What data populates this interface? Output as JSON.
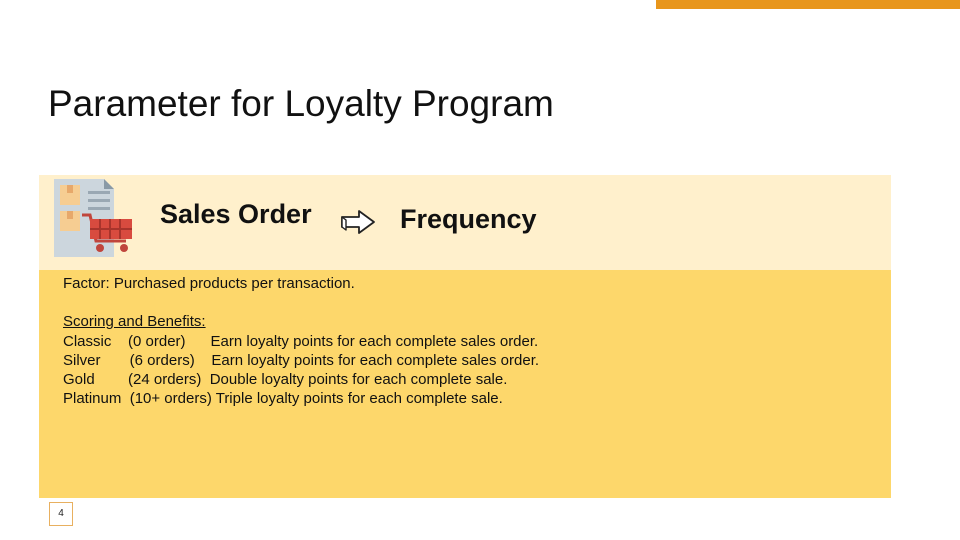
{
  "slide": {
    "title": "Parameter for Loyalty Program",
    "page_number": "4",
    "accent_color": "#e8961c",
    "header_band_color": "#fff0cc",
    "body_band_color": "#fdd76b"
  },
  "header": {
    "left_label": "Sales Order",
    "arrow_icon": "right-arrow-outline-icon",
    "right_label": "Frequency",
    "order_icon": "sales-order-cart-icon"
  },
  "content": {
    "factor": "Factor: Purchased products per transaction.",
    "scoring_heading": "Scoring and Benefits:",
    "tiers": [
      "Classic    (0 order)      Earn loyalty points for each complete sales order.",
      "Silver       (6 orders)    Earn loyalty points for each complete sales order.",
      "Gold        (24 orders)  Double loyalty points for each complete sale.",
      "Platinum  (10+ orders) Triple loyalty points for each complete sale."
    ]
  }
}
